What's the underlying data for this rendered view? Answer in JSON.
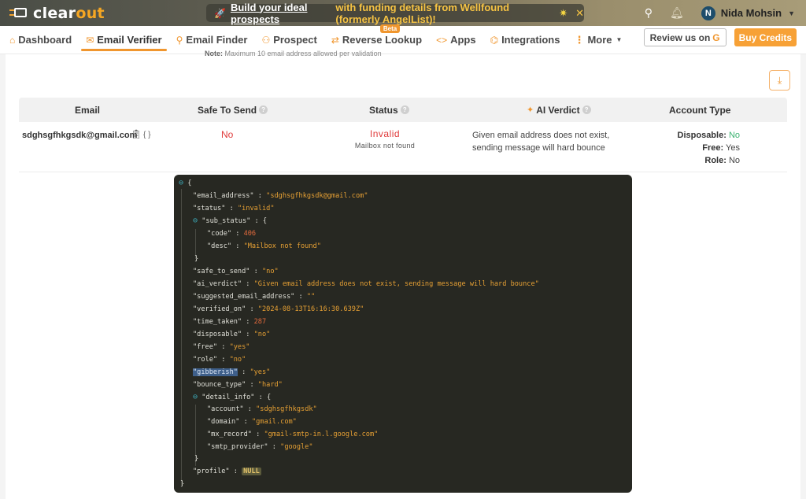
{
  "app": {
    "logo_part1": "clear",
    "logo_part2": "out"
  },
  "promo": {
    "link_text": "Build your ideal prospects",
    "rest_text": " with funding details from Wellfound (formerly AngelList)!",
    "close": "✕"
  },
  "user": {
    "initial": "N",
    "name": "Nida Mohsin"
  },
  "nav": {
    "items": [
      {
        "label": "Dashboard",
        "icon": "dashboard-icon",
        "glyph": "⌂"
      },
      {
        "label": "Email Verifier",
        "icon": "envelope-icon",
        "glyph": "✉"
      },
      {
        "label": "Email Finder",
        "icon": "search-icon",
        "glyph": "⚲"
      },
      {
        "label": "Prospect",
        "icon": "users-icon",
        "glyph": "⚇"
      },
      {
        "label": "Reverse Lookup",
        "icon": "swap-icon",
        "glyph": "⇄"
      },
      {
        "label": "Apps",
        "icon": "code-icon",
        "glyph": "<>"
      },
      {
        "label": "Integrations",
        "icon": "puzzle-icon",
        "glyph": "⌬"
      },
      {
        "label": "More",
        "icon": "more-icon",
        "glyph": "⋮"
      }
    ],
    "active": "Email Verifier",
    "beta_badge": "Beta",
    "review_label": "Review us on",
    "buy_label": "Buy Credits"
  },
  "note": {
    "label": "Note:",
    "text": "Maximum 10 email address allowed per validation"
  },
  "table": {
    "headers": {
      "email": "Email",
      "safe_to_send": "Safe To Send",
      "status": "Status",
      "ai_verdict": "AI Verdict",
      "account_type": "Account Type"
    },
    "rows": [
      {
        "email": "sdghsgfhkgsdk@gmail.com",
        "safe_to_send": "No",
        "status": "Invalid",
        "sub_status": "Mailbox not found",
        "ai_verdict": "Given email address does not exist, sending message will hard bounce",
        "disposable_label": "Disposable:",
        "disposable": "No",
        "free_label": "Free:",
        "free": "Yes",
        "role_label": "Role:",
        "role": "No"
      }
    ]
  },
  "json_view": {
    "email_address": "\"sdghsgfhkgsdk@gmail.com\"",
    "status": "\"invalid\"",
    "sub_status_code": "406",
    "sub_status_desc": "\"Mailbox not found\"",
    "safe_to_send": "\"no\"",
    "ai_verdict": "\"Given email address does not exist, sending message will hard bounce\"",
    "suggested_email_address": "\"\"",
    "verified_on": "\"2024-08-13T16:16:30.639Z\"",
    "time_taken": "287",
    "disposable": "\"no\"",
    "free": "\"yes\"",
    "role": "\"no\"",
    "gibberish": "\"yes\"",
    "bounce_type": "\"hard\"",
    "account": "\"sdghsgfhkgsdk\"",
    "domain": "\"gmail.com\"",
    "mx_record": "\"gmail-smtp-in.l.google.com\"",
    "smtp_provider": "\"google\"",
    "profile": "NULL"
  },
  "colors": {
    "accent": "#f0962e",
    "invalid": "#e03b3b",
    "positive": "#3cb371",
    "json_bg": "#272822"
  }
}
